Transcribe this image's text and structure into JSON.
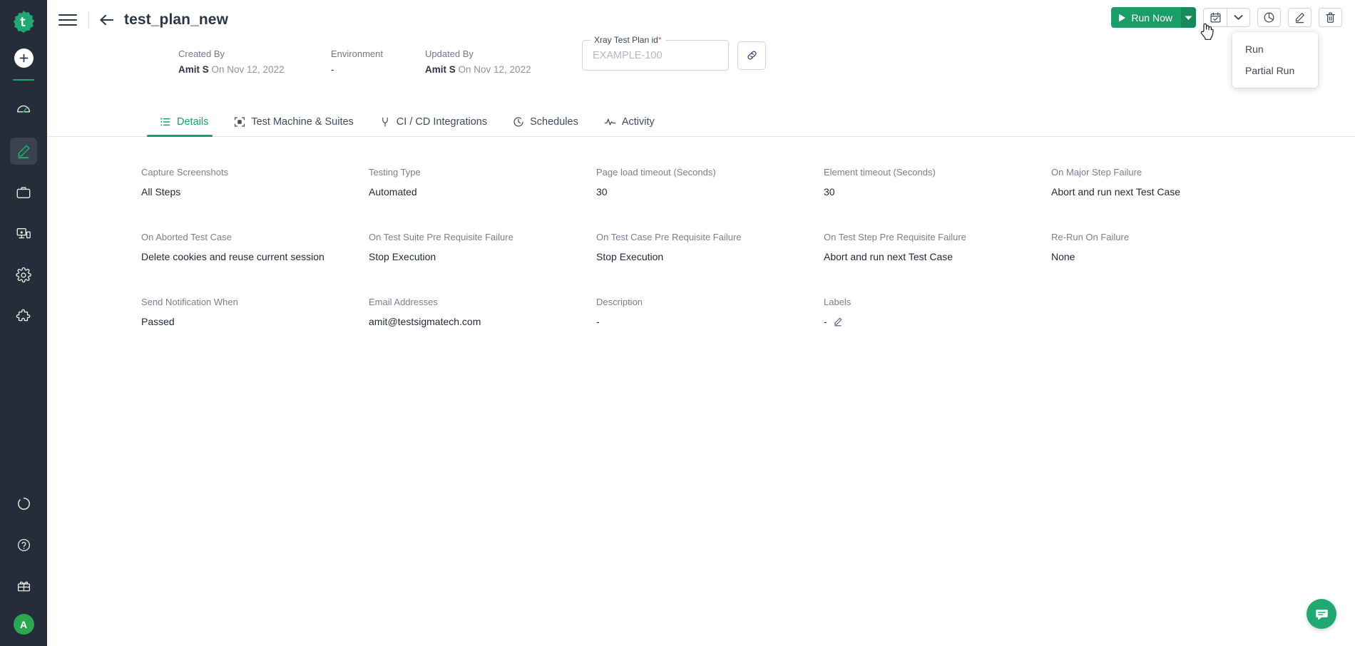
{
  "sidebar": {
    "logo_icon": "testsigma-logo-icon",
    "add_button": "add-icon",
    "items": [
      {
        "icon": "dashboard-speedometer-icon",
        "name": "dashboard",
        "active": false
      },
      {
        "icon": "pencil-create-icon",
        "name": "create-tests",
        "active": true
      },
      {
        "icon": "briefcase-icon",
        "name": "projects",
        "active": false
      },
      {
        "icon": "devices-test-lab-icon",
        "name": "test-lab",
        "active": false
      },
      {
        "icon": "gear-settings-icon",
        "name": "settings",
        "active": false
      },
      {
        "icon": "puzzle-addons-icon",
        "name": "addons",
        "active": false
      }
    ],
    "bottom_items": [
      {
        "icon": "progress-circle-icon",
        "name": "progress"
      },
      {
        "icon": "help-question-icon",
        "name": "help"
      },
      {
        "icon": "gift-icon",
        "name": "whats-new"
      }
    ],
    "avatar_initial": "A"
  },
  "header": {
    "menu_icon": "hamburger-menu-icon",
    "back_icon": "back-arrow-icon",
    "title": "test_plan_new"
  },
  "toolbar": {
    "run_now_label": "Run Now",
    "run_now_icon": "play-icon",
    "caret_icon": "chevron-down-icon",
    "schedule_icon": "calendar-schedule-icon",
    "schedule_caret_icon": "chevron-down-icon",
    "report_icon": "pie-chart-report-icon",
    "edit_icon": "pencil-edit-icon",
    "delete_icon": "trash-delete-icon"
  },
  "dropdown": {
    "visible": true,
    "items": [
      {
        "label": "Run"
      },
      {
        "label": "Partial Run"
      }
    ]
  },
  "meta": {
    "created_by": {
      "label": "Created By",
      "user": "Amit S",
      "on": " On Nov 12, 2022"
    },
    "environment": {
      "label": "Environment",
      "value": "-"
    },
    "updated_by": {
      "label": "Updated By",
      "user": "Amit S",
      "on": " On Nov 12, 2022"
    },
    "xray": {
      "legend": "Xray Test Plan id",
      "required_marker": "*",
      "value": "",
      "placeholder": "EXAMPLE-100",
      "link_icon": "link-chain-icon"
    }
  },
  "tabs": [
    {
      "label": "Details",
      "icon": "list-details-icon",
      "active": true
    },
    {
      "label": "Test Machine & Suites",
      "icon": "test-machine-icon",
      "active": false
    },
    {
      "label": "CI / CD Integrations",
      "icon": "plug-integration-icon",
      "active": false
    },
    {
      "label": "Schedules",
      "icon": "clock-schedule-icon",
      "active": false
    },
    {
      "label": "Activity",
      "icon": "activity-pulse-icon",
      "active": false
    }
  ],
  "details": {
    "rows": [
      [
        {
          "label": "Capture Screenshots",
          "value": "All Steps"
        },
        {
          "label": "Testing Type",
          "value": "Automated"
        },
        {
          "label": "Page load timeout (Seconds)",
          "value": "30"
        },
        {
          "label": "Element timeout (Seconds)",
          "value": "30"
        },
        {
          "label": "On Major Step Failure",
          "value": "Abort and run next Test Case"
        }
      ],
      [
        {
          "label": "On Aborted Test Case",
          "value": "Delete cookies and reuse current session"
        },
        {
          "label": "On Test Suite Pre Requisite Failure",
          "value": "Stop Execution"
        },
        {
          "label": "On Test Case Pre Requisite Failure",
          "value": "Stop Execution"
        },
        {
          "label": "On Test Step Pre Requisite Failure",
          "value": "Abort and run next Test Case"
        },
        {
          "label": "Re-Run On Failure",
          "value": "None"
        }
      ],
      [
        {
          "label": "Send Notification When",
          "value": "Passed"
        },
        {
          "label": "Email Addresses",
          "value": "amit@testsigmatech.com"
        },
        {
          "label": "Description",
          "value": "-"
        },
        {
          "label": "Labels",
          "value": "-",
          "edit_icon": "pencil-edit-icon"
        }
      ]
    ]
  },
  "chat": {
    "icon": "chat-bubble-icon"
  },
  "colors": {
    "accent_green": "#1a9e68",
    "accent_green_dark": "#168a5b",
    "rail_bg": "#252d3a",
    "avatar_green": "#2aa84f",
    "chat_green": "#1fa971",
    "required_red": "#e2574c",
    "text_dark": "#2b3648",
    "text_muted": "#77808f"
  }
}
